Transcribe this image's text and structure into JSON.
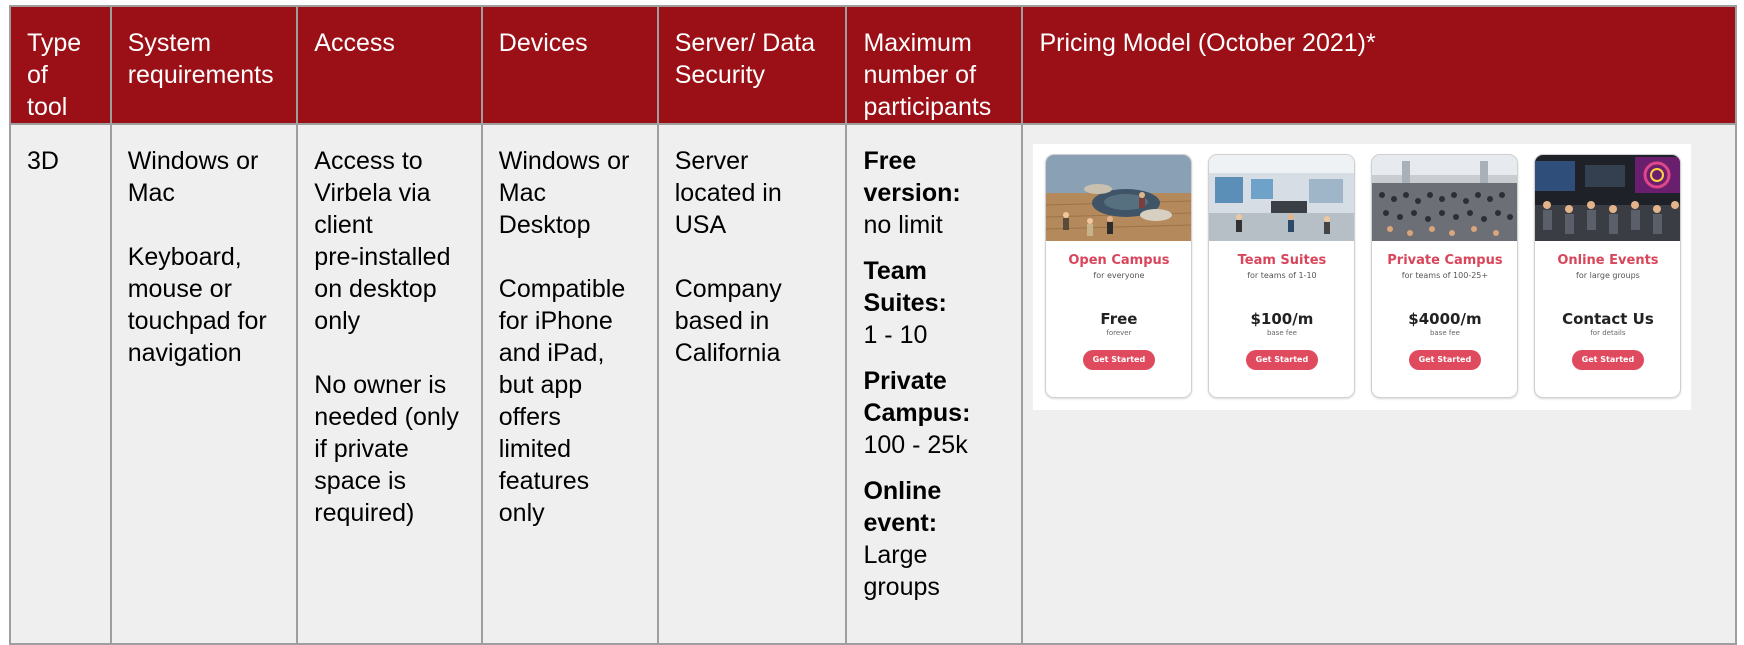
{
  "headers": [
    "Type\nof\ntool",
    "System\nrequirements",
    "Access",
    "Devices",
    "Server/ Data\nSecurity",
    "Maximum\nnumber of\nparticipants",
    "Pricing Model (October 2021)*"
  ],
  "row": {
    "type": "3D",
    "system": [
      "Windows or\nMac",
      "Keyboard,\nmouse or\ntouchpad for\nnavigation"
    ],
    "access": [
      "Access to\nVirbela via\nclient\npre-installed\non desktop\nonly",
      "No owner is\nneeded (only\nif private\nspace is\nrequired)"
    ],
    "devices": [
      "Windows or\nMac\nDesktop",
      "Compatible\nfor iPhone\nand iPad,\nbut app\noffers\nlimited\nfeatures\nonly"
    ],
    "server": [
      "Server\nlocated in\nUSA",
      "Company\nbased in\nCalifornia"
    ],
    "participants": [
      {
        "label": "Free\nversion:",
        "value": "no limit"
      },
      {
        "label": "Team\nSuites:",
        "value": "1 - 10"
      },
      {
        "label": "Private\nCampus:",
        "value": "100 - 25k"
      },
      {
        "label": "Online\nevent:",
        "value": "Large\ngroups"
      }
    ]
  },
  "pricing": [
    {
      "name": "Open Campus",
      "sub": "for everyone",
      "price": "Free",
      "note": "forever",
      "button": "Get Started"
    },
    {
      "name": "Team Suites",
      "sub": "for teams of 1-10",
      "price": "$100/m",
      "note": "base fee",
      "button": "Get Started"
    },
    {
      "name": "Private Campus",
      "sub": "for teams of 100-25+",
      "price": "$4000/m",
      "note": "base fee",
      "button": "Get Started"
    },
    {
      "name": "Online Events",
      "sub": "for large groups",
      "price": "Contact Us",
      "note": "for details",
      "button": "Get Started"
    }
  ],
  "colors": {
    "header_bg": "#9b0f16",
    "body_bg": "#efefef",
    "accent": "#d9455a",
    "button": "#e04a5e"
  }
}
